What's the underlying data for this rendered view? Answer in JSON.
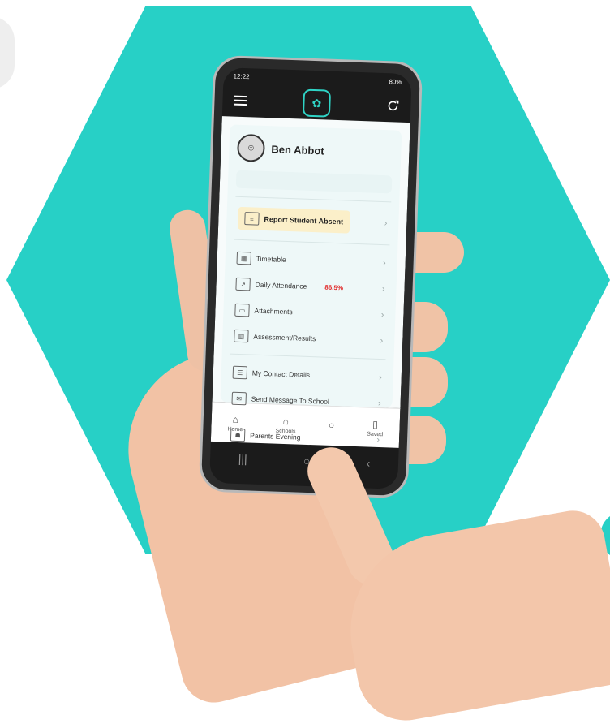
{
  "status": {
    "time": "12:22",
    "battery": "80%"
  },
  "app": {
    "profile_name": "Ben Abbot",
    "report_absent_label": "Report Student Absent",
    "menu": [
      {
        "label": "Timetable",
        "icon": "calendar-grid-icon"
      },
      {
        "label": "Daily Attendance",
        "icon": "chart-line-icon",
        "value": "86.5%"
      },
      {
        "label": "Attachments",
        "icon": "folder-icon"
      },
      {
        "label": "Assessment/Results",
        "icon": "bar-chart-icon"
      },
      {
        "label": "My Contact Details",
        "icon": "contact-card-icon"
      },
      {
        "label": "Send Message To School",
        "icon": "message-icon"
      },
      {
        "label": "Parents Evening",
        "icon": "parents-evening-icon"
      }
    ],
    "bottom_nav": [
      {
        "label": "Home",
        "icon": "home-icon"
      },
      {
        "label": "Schools",
        "icon": "school-icon"
      },
      {
        "label": "",
        "icon": "profile-icon"
      },
      {
        "label": "Saved",
        "icon": "bookmark-icon"
      }
    ]
  },
  "colors": {
    "hexagon": "#27d0c6",
    "accent": "#2fd4c6",
    "alert": "#e12b2b",
    "report_highlight": "#fbefc9"
  }
}
